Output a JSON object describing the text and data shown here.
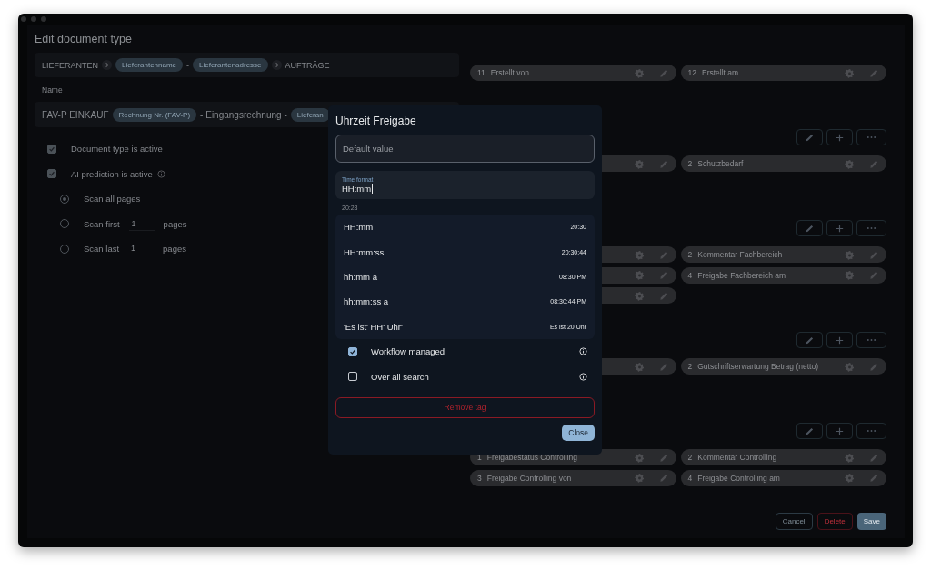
{
  "window": {
    "title": "Edit document type"
  },
  "breadcrumb": [
    {
      "kind": "text",
      "text": "LIEFERANTEN"
    },
    {
      "kind": "sep"
    },
    {
      "kind": "chip",
      "text": "Lieferantenname"
    },
    {
      "kind": "text",
      "text": "-"
    },
    {
      "kind": "chip",
      "text": "Lieferantenadresse"
    },
    {
      "kind": "sep"
    },
    {
      "kind": "text",
      "text": "AUFTRÄGE"
    }
  ],
  "name_label": "Name",
  "name_parts": [
    {
      "kind": "text",
      "text": "FAV-P EINKAUF"
    },
    {
      "kind": "chip",
      "text": "Rechnung Nr. (FAV-P)"
    },
    {
      "kind": "text",
      "text": "- Eingangsrechnung -"
    },
    {
      "kind": "chip",
      "text": "Lieferan"
    }
  ],
  "options": [
    {
      "kind": "checkbox",
      "label": "Document type is active",
      "checked": true,
      "info": false
    },
    {
      "kind": "checkbox",
      "label": "AI prediction is active",
      "checked": true,
      "info": true
    },
    {
      "kind": "radio",
      "label": "Scan all pages",
      "selected": true
    },
    {
      "kind": "radio",
      "label": "Scan first",
      "count": "1",
      "suffix": "pages",
      "selected": false
    },
    {
      "kind": "radio",
      "label": "Scan last",
      "count": "1",
      "suffix": "pages",
      "selected": false
    }
  ],
  "sections": [
    {
      "fields": [
        {
          "kind": "field",
          "number": "11",
          "label": "Erstellt von"
        },
        {
          "kind": "field",
          "number": "12",
          "label": "Erstellt am"
        }
      ]
    },
    {
      "fields": [
        {
          "kind": "covered"
        },
        {
          "kind": "field",
          "number": "2",
          "label": "Schutzbedarf"
        }
      ]
    },
    {
      "fields": [
        {
          "kind": "covered"
        },
        {
          "kind": "field",
          "number": "2",
          "label": "Kommentar Fachbereich"
        },
        {
          "kind": "covered"
        },
        {
          "kind": "field",
          "number": "4",
          "label": "Freigabe Fachbereich am"
        },
        {
          "kind": "covered"
        }
      ]
    },
    {
      "fields": [
        {
          "kind": "covered"
        },
        {
          "kind": "field",
          "number": "2",
          "label": "Gutschriftserwartung Betrag (netto)"
        }
      ]
    },
    {
      "fields": [
        {
          "kind": "field",
          "number": "1",
          "label": "Freigabestatus Controlling"
        },
        {
          "kind": "field",
          "number": "2",
          "label": "Kommentar Controlling"
        },
        {
          "kind": "field",
          "number": "3",
          "label": "Freigabe Controlling von"
        },
        {
          "kind": "field",
          "number": "4",
          "label": "Freigabe Controlling am"
        }
      ]
    }
  ],
  "footer_buttons": [
    {
      "kind": "cancel",
      "label": "Cancel"
    },
    {
      "kind": "delete",
      "label": "Delete"
    },
    {
      "kind": "save",
      "label": "Save"
    }
  ],
  "dialog": {
    "title": "Uhrzeit Freigabe",
    "default_value": {
      "placeholder": "Default value"
    },
    "time_format": {
      "label": "Time format",
      "value": "HH:mm",
      "helper": "20:28"
    },
    "formats": [
      {
        "format": "HH:mm",
        "example": "20:30"
      },
      {
        "format": "HH:mm:ss",
        "example": "20:30:44"
      },
      {
        "format": "hh:mm a",
        "example": "08:30 PM"
      },
      {
        "format": "hh:mm:ss a",
        "example": "08:30:44 PM"
      },
      {
        "format": "'Es ist' HH' Uhr'",
        "example": "Es ist 20 Uhr"
      }
    ],
    "toggles": [
      {
        "label": "Workflow managed",
        "checked": true
      },
      {
        "label": "Over all search",
        "checked": false
      }
    ],
    "remove_button": "Remove tag",
    "close_button": "Close"
  }
}
